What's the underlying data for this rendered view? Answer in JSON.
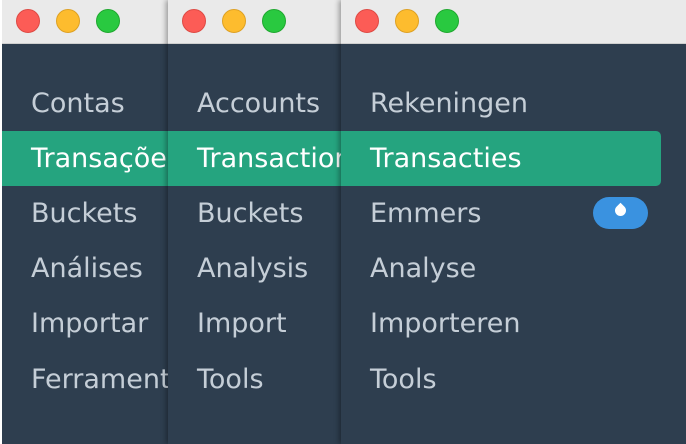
{
  "windows": [
    {
      "lang": "pt",
      "items": [
        {
          "label": "Contas",
          "active": false
        },
        {
          "label": "Transações",
          "active": true
        },
        {
          "label": "Buckets",
          "active": false
        },
        {
          "label": "Análises",
          "active": false
        },
        {
          "label": "Importar",
          "active": false
        },
        {
          "label": "Ferramentas",
          "active": false
        }
      ]
    },
    {
      "lang": "en",
      "items": [
        {
          "label": "Accounts",
          "active": false
        },
        {
          "label": "Transactions",
          "active": true
        },
        {
          "label": "Buckets",
          "active": false
        },
        {
          "label": "Analysis",
          "active": false
        },
        {
          "label": "Import",
          "active": false
        },
        {
          "label": "Tools",
          "active": false
        }
      ]
    },
    {
      "lang": "nl",
      "items": [
        {
          "label": "Rekeningen",
          "active": false
        },
        {
          "label": "Transacties",
          "active": true
        },
        {
          "label": "Emmers",
          "active": false,
          "badge_icon": "water-drop-icon"
        },
        {
          "label": "Analyse",
          "active": false
        },
        {
          "label": "Importeren",
          "active": false
        },
        {
          "label": "Tools",
          "active": false
        }
      ]
    }
  ],
  "colors": {
    "sidebar_bg": "#2e3e4f",
    "active_bg": "#25a47f",
    "text": "#c5ced7",
    "active_text": "#ffffff",
    "badge_bg": "#3a92e0",
    "titlebar_bg": "#eaeaea",
    "close": "#fc5c56",
    "minimize": "#fdbc2e",
    "zoom": "#29c940"
  }
}
